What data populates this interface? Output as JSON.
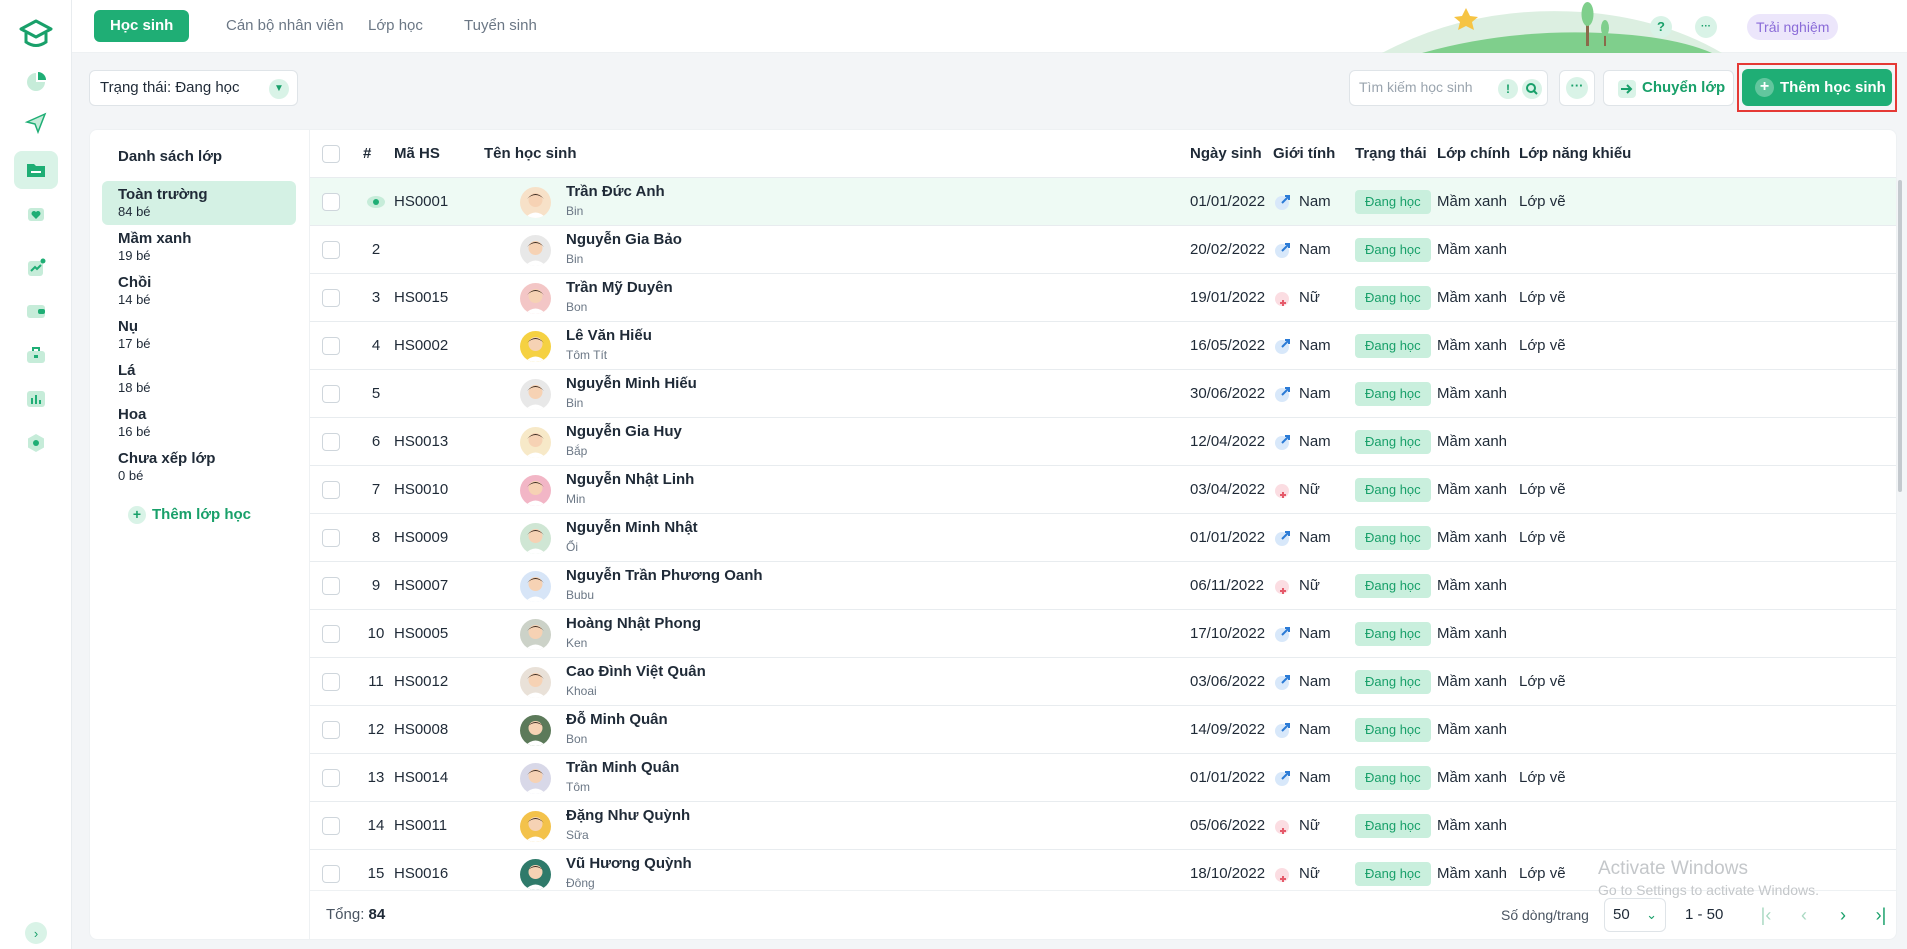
{
  "nav_tabs": [
    {
      "label": "Học sinh"
    },
    {
      "label": "Cán bộ nhân viên"
    },
    {
      "label": "Lớp học"
    },
    {
      "label": "Tuyển sinh"
    }
  ],
  "topbar": {
    "help": "?",
    "more": "···",
    "trial": "Trải nghiệm"
  },
  "filters": {
    "status": "Trạng thái: Đang học"
  },
  "search": {
    "placeholder": "Tìm kiếm học sinh",
    "warn": "!"
  },
  "toolbar": {
    "more": "···",
    "transfer": "Chuyển lớp",
    "add_student": "Thêm học sinh"
  },
  "classlist": {
    "title": "Danh sách lớp",
    "items": [
      {
        "name": "Toàn trường",
        "count": "84 bé"
      },
      {
        "name": "Mầm xanh",
        "count": "19 bé"
      },
      {
        "name": "Chồi",
        "count": "14 bé"
      },
      {
        "name": "Nụ",
        "count": "17 bé"
      },
      {
        "name": "Lá",
        "count": "18 bé"
      },
      {
        "name": "Hoa",
        "count": "16 bé"
      },
      {
        "name": "Chưa xếp lớp",
        "count": "0 bé"
      }
    ],
    "add_label": "Thêm lớp học"
  },
  "table": {
    "columns": [
      "#",
      "Mã HS",
      "Tên học sinh",
      "Ngày sinh",
      "Giới tính",
      "Trạng thái",
      "Lớp chính",
      "Lớp năng khiếu"
    ],
    "rows": [
      {
        "no": "",
        "code": "HS0001",
        "name": "Trần Đức Anh",
        "nick": "Bin",
        "dob": "01/01/2022",
        "gender": "Nam",
        "status": "Đang học",
        "main": "Mầm xanh",
        "talent": "Lớp vẽ"
      },
      {
        "no": "2",
        "code": "",
        "name": "Nguyễn Gia Bảo",
        "nick": "Bin",
        "dob": "20/02/2022",
        "gender": "Nam",
        "status": "Đang học",
        "main": "Mầm xanh",
        "talent": ""
      },
      {
        "no": "3",
        "code": "HS0015",
        "name": "Trần Mỹ Duyên",
        "nick": "Bon",
        "dob": "19/01/2022",
        "gender": "Nữ",
        "status": "Đang học",
        "main": "Mầm xanh",
        "talent": "Lớp vẽ"
      },
      {
        "no": "4",
        "code": "HS0002",
        "name": "Lê Văn Hiếu",
        "nick": "Tôm Tít",
        "dob": "16/05/2022",
        "gender": "Nam",
        "status": "Đang học",
        "main": "Mầm xanh",
        "talent": "Lớp vẽ"
      },
      {
        "no": "5",
        "code": "",
        "name": "Nguyễn Minh Hiếu",
        "nick": "Bin",
        "dob": "30/06/2022",
        "gender": "Nam",
        "status": "Đang học",
        "main": "Mầm xanh",
        "talent": ""
      },
      {
        "no": "6",
        "code": "HS0013",
        "name": "Nguyễn Gia Huy",
        "nick": "Bắp",
        "dob": "12/04/2022",
        "gender": "Nam",
        "status": "Đang học",
        "main": "Mầm xanh",
        "talent": ""
      },
      {
        "no": "7",
        "code": "HS0010",
        "name": "Nguyễn Nhật Linh",
        "nick": "Min",
        "dob": "03/04/2022",
        "gender": "Nữ",
        "status": "Đang học",
        "main": "Mầm xanh",
        "talent": "Lớp vẽ"
      },
      {
        "no": "8",
        "code": "HS0009",
        "name": "Nguyễn Minh Nhật",
        "nick": "Ổi",
        "dob": "01/01/2022",
        "gender": "Nam",
        "status": "Đang học",
        "main": "Mầm xanh",
        "talent": "Lớp vẽ"
      },
      {
        "no": "9",
        "code": "HS0007",
        "name": "Nguyễn Trần Phương Oanh",
        "nick": "Bubu",
        "dob": "06/11/2022",
        "gender": "Nữ",
        "status": "Đang học",
        "main": "Mầm xanh",
        "talent": ""
      },
      {
        "no": "10",
        "code": "HS0005",
        "name": "Hoàng Nhật Phong",
        "nick": "Ken",
        "dob": "17/10/2022",
        "gender": "Nam",
        "status": "Đang học",
        "main": "Mầm xanh",
        "talent": ""
      },
      {
        "no": "11",
        "code": "HS0012",
        "name": "Cao Đình Việt Quân",
        "nick": "Khoai",
        "dob": "03/06/2022",
        "gender": "Nam",
        "status": "Đang học",
        "main": "Mầm xanh",
        "talent": "Lớp vẽ"
      },
      {
        "no": "12",
        "code": "HS0008",
        "name": "Đỗ Minh Quân",
        "nick": "Bon",
        "dob": "14/09/2022",
        "gender": "Nam",
        "status": "Đang học",
        "main": "Mầm xanh",
        "talent": ""
      },
      {
        "no": "13",
        "code": "HS0014",
        "name": "Trần Minh Quân",
        "nick": "Tôm",
        "dob": "01/01/2022",
        "gender": "Nam",
        "status": "Đang học",
        "main": "Mầm xanh",
        "talent": "Lớp vẽ"
      },
      {
        "no": "14",
        "code": "HS0011",
        "name": "Đặng Như Quỳnh",
        "nick": "Sữa",
        "dob": "05/06/2022",
        "gender": "Nữ",
        "status": "Đang học",
        "main": "Mầm xanh",
        "talent": ""
      },
      {
        "no": "15",
        "code": "HS0016",
        "name": "Vũ Hương Quỳnh",
        "nick": "Đông",
        "dob": "18/10/2022",
        "gender": "Nữ",
        "status": "Đang học",
        "main": "Mầm xanh",
        "talent": "Lớp vẽ"
      }
    ]
  },
  "footer": {
    "total_label": "Tổng:",
    "total_value": "84",
    "per_page_label": "Số dòng/trang",
    "per_page_value": "50",
    "range": "1 - 50"
  },
  "watermark": {
    "line1": "Activate Windows",
    "line2": "Go to Settings to activate Windows."
  },
  "colors": {
    "accent": "#1fae75",
    "male": "#2b7bd6",
    "female": "#e55a6a"
  }
}
